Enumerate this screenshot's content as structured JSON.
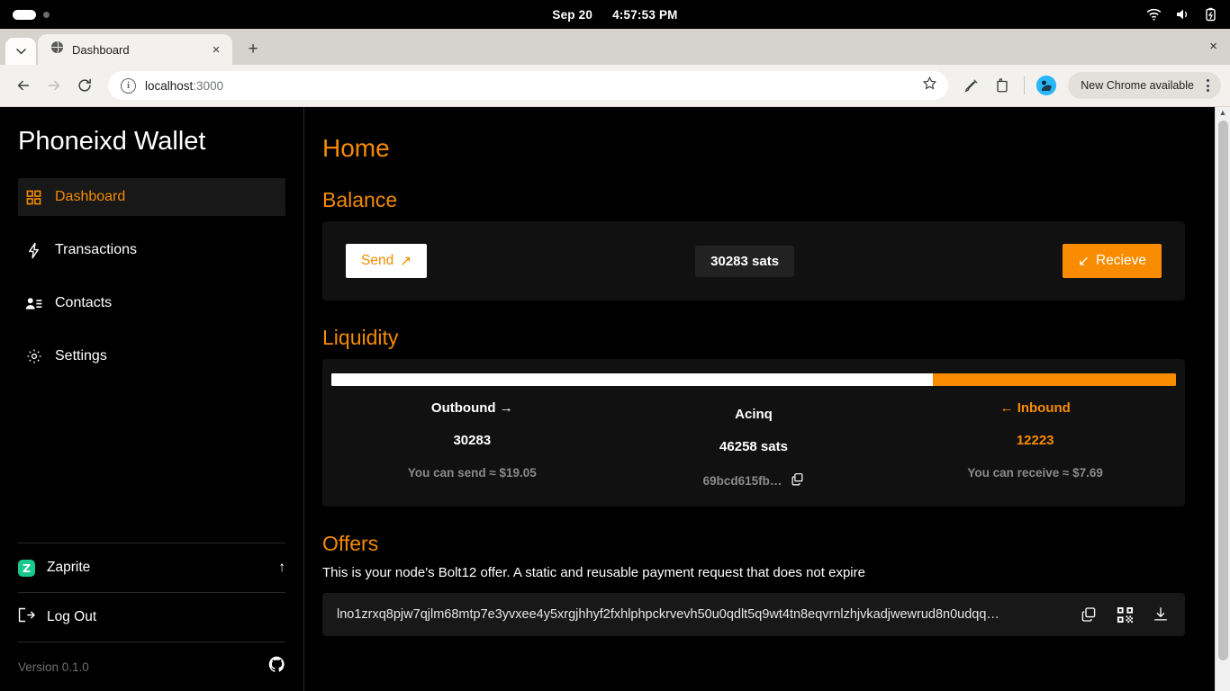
{
  "os_bar": {
    "date": "Sep 20",
    "time": "4:57:53 PM",
    "icons": [
      "wifi-icon",
      "volume-icon",
      "battery-charging-icon"
    ]
  },
  "browser": {
    "tab": {
      "title": "Dashboard",
      "favicon": "globe-icon",
      "close_label": "×"
    },
    "new_tab_label": "+",
    "window_close_label": "×",
    "tab_list_chevron": "⌄",
    "toolbar": {
      "back_label": "←",
      "forward_label": "→",
      "reload_label": "⟳",
      "site_info_label": "i",
      "url_host": "localhost",
      "url_port": ":3000",
      "bookmark_label": "☆",
      "update_pill_label": "New Chrome available"
    }
  },
  "sidebar": {
    "brand": "Phoneixd Wallet",
    "items": [
      {
        "label": "Dashboard",
        "icon": "grid-icon",
        "active": true
      },
      {
        "label": "Transactions",
        "icon": "lightning-icon",
        "active": false
      },
      {
        "label": "Contacts",
        "icon": "contacts-icon",
        "active": false
      },
      {
        "label": "Settings",
        "icon": "gear-icon",
        "active": false
      }
    ],
    "zaprite": {
      "label": "Zaprite",
      "badge_letter": "Z",
      "link_arrow": "↑"
    },
    "logout": {
      "label": "Log Out",
      "icon": "logout-icon"
    },
    "version": "Version 0.1.0",
    "github_icon": "github-icon"
  },
  "main": {
    "page_title": "Home",
    "balance": {
      "heading": "Balance",
      "send_label": "Send",
      "send_arrow": "↗",
      "amount": "30283 sats",
      "receive_label": "Recieve",
      "receive_arrow": "↙"
    },
    "liquidity": {
      "heading": "Liquidity",
      "bar": {
        "outbound_pct": 71.2,
        "inbound_pct": 28.8
      },
      "outbound": {
        "title": "Outbound",
        "arrow": "→",
        "value": "30283",
        "note": "You can send ≈ $19.05"
      },
      "peer": {
        "title": "Acinq",
        "value": "46258 sats",
        "node_id": "69bcd615fb…",
        "copy_icon": "copy-icon"
      },
      "inbound": {
        "title": "Inbound",
        "arrow": "←",
        "value": "12223",
        "note": "You can receive ≈ $7.69"
      }
    },
    "offers": {
      "heading": "Offers",
      "description": "This is your node's Bolt12 offer. A static and reusable payment request that does not expire",
      "offer_string": "lno1zrxq8pjw7qjlm68mtp7e3yvxee4y5xrgjhhyf2fxhlphpckrvevh50u0qdlt5q9wt4tn8eqvrnlzhjvkadjwewrud8n0udqq…",
      "copy_icon": "copy-icon",
      "qr_icon": "qr-code-icon",
      "download_icon": "download-icon"
    }
  },
  "colors": {
    "accent": "#f98b00",
    "page_bg": "#000000",
    "card_bg": "#111111",
    "muted_text": "#8a8a8a",
    "zaprite_green": "#17c98c"
  }
}
